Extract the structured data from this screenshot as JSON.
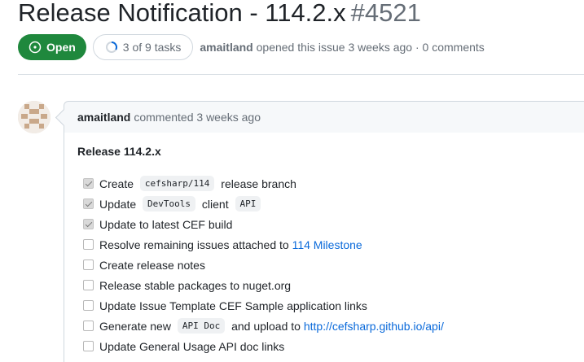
{
  "issue": {
    "title": "Release Notification - 114.2.x",
    "number": "#4521",
    "state_label": "Open",
    "tasks_label": "3 of 9 tasks",
    "tasks_done": 3,
    "tasks_total": 9,
    "author": "amaitland",
    "opened_text": "opened this issue 3 weeks ago · 0 comments"
  },
  "comment": {
    "author": "amaitland",
    "meta": "commented 3 weeks ago",
    "heading": "Release 114.2.x",
    "tasks": [
      {
        "checked": true,
        "segments": [
          {
            "t": "Create "
          },
          {
            "t": "cefsharp/114",
            "code": true
          },
          {
            "t": " release branch"
          }
        ]
      },
      {
        "checked": true,
        "segments": [
          {
            "t": "Update "
          },
          {
            "t": "DevTools",
            "code": true
          },
          {
            "t": " client "
          },
          {
            "t": "API",
            "code": true
          }
        ]
      },
      {
        "checked": true,
        "segments": [
          {
            "t": "Update to latest CEF build"
          }
        ]
      },
      {
        "checked": false,
        "segments": [
          {
            "t": "Resolve remaining issues attached to "
          },
          {
            "t": "114 Milestone",
            "link": true
          }
        ]
      },
      {
        "checked": false,
        "segments": [
          {
            "t": "Create release notes"
          }
        ]
      },
      {
        "checked": false,
        "segments": [
          {
            "t": "Release stable packages to nuget.org"
          }
        ]
      },
      {
        "checked": false,
        "segments": [
          {
            "t": "Update Issue Template CEF Sample application links"
          }
        ]
      },
      {
        "checked": false,
        "segments": [
          {
            "t": "Generate new "
          },
          {
            "t": "API Doc",
            "code": true
          },
          {
            "t": " and upload to "
          },
          {
            "t": "http://cefsharp.github.io/api/",
            "link": true
          }
        ]
      },
      {
        "checked": false,
        "segments": [
          {
            "t": "Update General Usage API doc links"
          }
        ]
      }
    ]
  },
  "colors": {
    "open_green": "#1f883d",
    "link_blue": "#0969da",
    "muted_text": "#656d76",
    "progress_ring": "#0969da"
  },
  "icons": {
    "state": "issue-opened-icon",
    "progress": "task-progress-ring-icon",
    "avatar": "identicon-avatar"
  }
}
